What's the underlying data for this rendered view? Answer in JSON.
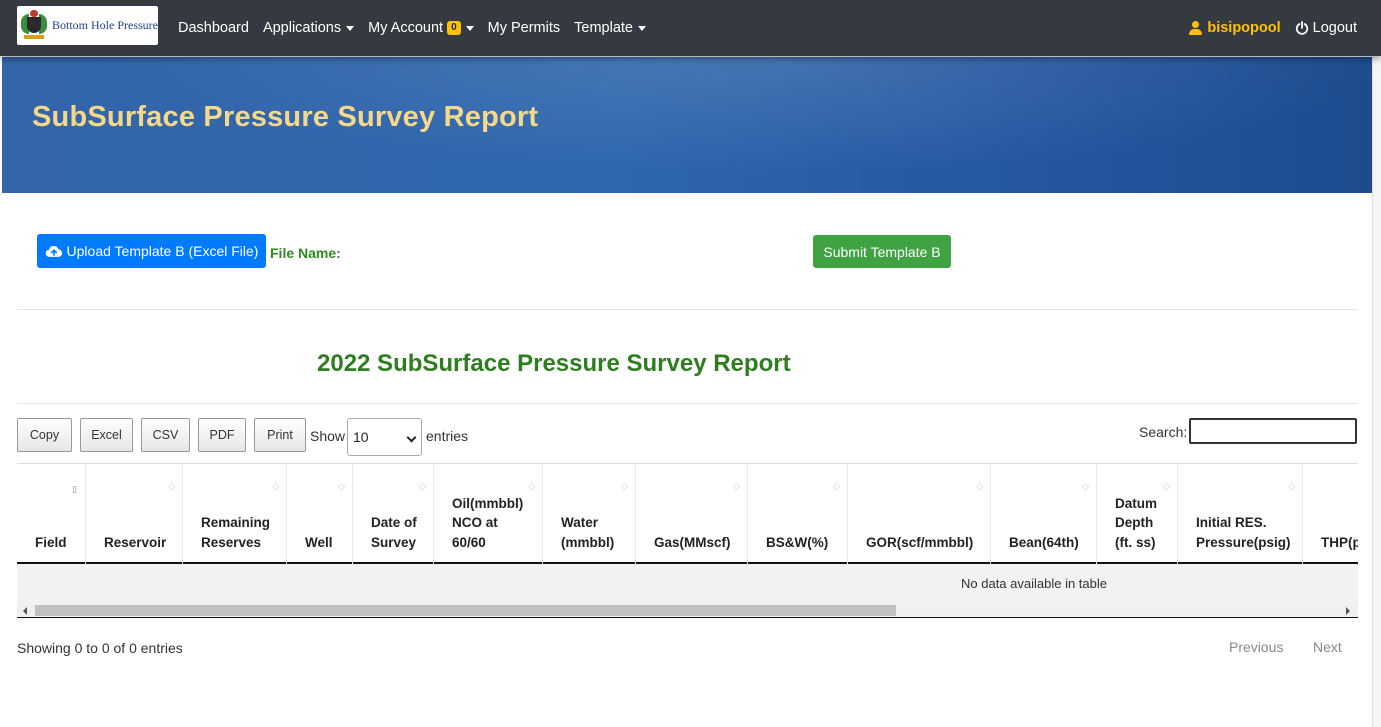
{
  "navbar": {
    "logo_text": "Bottom Hole Pressure",
    "items": [
      {
        "label": "Dashboard",
        "dropdown": false
      },
      {
        "label": "Applications",
        "dropdown": true
      },
      {
        "label": "My Account",
        "badge": "0",
        "dropdown": true
      },
      {
        "label": "My Permits",
        "dropdown": false
      },
      {
        "label": "Template",
        "dropdown": true
      }
    ],
    "username": "bisipopool",
    "logout_label": "Logout"
  },
  "hero": {
    "title": "SubSurface Pressure Survey Report"
  },
  "actions": {
    "upload_label": "Upload Template B (Excel File)",
    "file_name_label": "File Name:",
    "submit_label": "Submit Template B"
  },
  "report_title": "2022 SubSurface Pressure Survey Report",
  "toolbar": {
    "buttons": [
      "Copy",
      "Excel",
      "CSV",
      "PDF",
      "Print"
    ],
    "show_label": "Show",
    "entries_value": "10",
    "entries_label": "entries",
    "search_label": "Search:",
    "search_value": ""
  },
  "table": {
    "columns": [
      "Field",
      "Reservoir",
      "Remaining Reserves",
      "Well",
      "Date of Survey",
      "Oil(mmbbl) NCO at 60/60",
      "Water (mmbbl)",
      "Gas(MMscf)",
      "BS&W(%)",
      "GOR(scf/mmbbl)",
      "Bean(64th)",
      "Datum Depth (ft. ss)",
      "Initial RES. Pressure(psig)",
      "THP(psig)"
    ],
    "empty_message": "No data available in table"
  },
  "footer": {
    "info": "Showing 0 to 0 of 0 entries",
    "previous": "Previous",
    "next": "Next"
  },
  "colors": {
    "navbar": "#343a40",
    "hero_title": "#f5d98b",
    "upload_button": "#007bff",
    "submit_button": "#3fa343",
    "report_title": "#2e7d1f",
    "username": "#ffc107"
  }
}
